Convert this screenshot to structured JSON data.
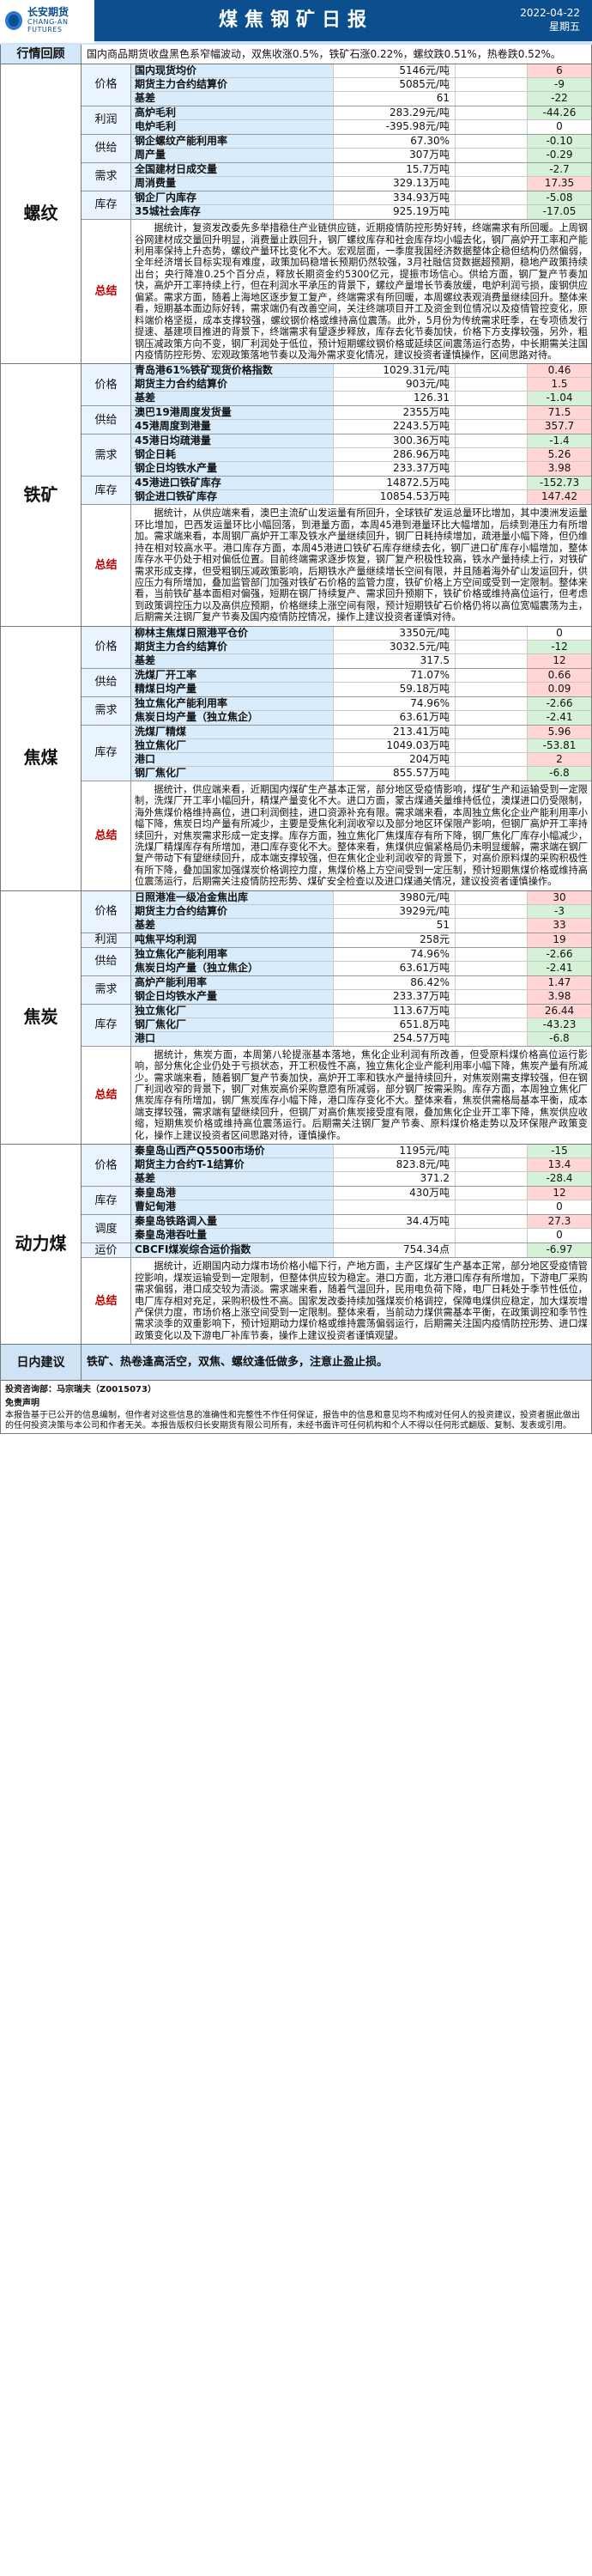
{
  "header": {
    "logo_cn": "长安期货",
    "logo_en": "CHANG-AN FUTURES",
    "title": "煤焦钢矿日报",
    "date": "2022-04-22",
    "weekday": "星期五"
  },
  "market": {
    "label": "行情回顾",
    "text": "国内商品期货收盘黑色系窄幅波动，双焦收涨0.5%，铁矿石涨0.22%，螺纹跌0.51%，热卷跌0.52%。"
  },
  "sections": [
    {
      "name": "螺纹",
      "groups": [
        {
          "label": "价格",
          "rows": [
            [
              "国内现货均价",
              "5146元/吨",
              "",
              "6"
            ],
            [
              "期货主力合约结算价",
              "5085元/吨",
              "",
              "-9"
            ],
            [
              "基差",
              "61",
              "",
              "-22"
            ]
          ]
        },
        {
          "label": "利润",
          "rows": [
            [
              "高炉毛利",
              "283.29元/吨",
              "",
              "-44.26"
            ],
            [
              "电炉毛利",
              "-395.98元/吨",
              "",
              "0"
            ]
          ]
        },
        {
          "label": "供给",
          "rows": [
            [
              "钢企螺纹产能利用率",
              "67.30%",
              "",
              "-0.10"
            ],
            [
              "周产量",
              "307万吨",
              "",
              "-0.29"
            ]
          ]
        },
        {
          "label": "需求",
          "rows": [
            [
              "全国建材日成交量",
              "15.7万吨",
              "",
              "-2.7"
            ],
            [
              "周消费量",
              "329.13万吨",
              "",
              "17.35"
            ]
          ]
        },
        {
          "label": "库存",
          "rows": [
            [
              "钢企厂内库存",
              "334.93万吨",
              "",
              "-5.08"
            ],
            [
              "35城社会库存",
              "925.19万吨",
              "",
              "-17.05"
            ]
          ]
        }
      ],
      "summary": "据统计，复资发改委先多举措稳住产业链供应链，近期疫情防控形势好转，终端需求有所回暖。上周钢谷网建材成交量回升明显，消费量止跌回升，钢厂螺纹库存和社会库存均小幅去化，钢厂高炉开工率和产能利用率保持上升态势，螺纹产量环比变化不大。宏观层面，一季度我国经济数据整体企稳但结构仍然偏弱，全年经济增长目标实现有难度，政策加码稳增长预期仍然较强，3月社融信贷数据超预期，稳地产政策持续出台；央行降准0.25个百分点，释放长期资金约5300亿元，提振市场信心。供给方面，钢厂复产节奏加快，高炉开工率持续上行，但在利润水平承压的背景下，螺纹产量增长节奏放缓，电炉利润亏损，废钢供应偏紧。需求方面，随着上海地区逐步复工复产，终端需求有所回暖，本周螺纹表观消费量继续回升。整体来看，短期基本面边际好转，需求端仍有改善空间，关注终端项目开工及资金到位情况以及疫情管控变化，原料端价格坚挺，成本支撑较强，螺纹钢价格或维持高位震荡。此外，5月份为传统需求旺季，在专项债发行提速、基建项目推进的背景下，终端需求有望逐步释放，库存去化节奏加快，价格下方支撑较强，另外，粗钢压减政策方向不变，钢厂利润处于低位，预计短期螺纹钢价格或延续区间震荡运行态势，中长期需关注国内疫情防控形势、宏观政策落地节奏以及海外需求变化情况，建议投资者谨慎操作，区间思路对待。"
    },
    {
      "name": "铁矿",
      "groups": [
        {
          "label": "价格",
          "rows": [
            [
              "青岛港61%铁矿现货价格指数",
              "1029.31元/吨",
              "",
              "0.46"
            ],
            [
              "期货主力合约结算价",
              "903元/吨",
              "",
              "1.5"
            ],
            [
              "基差",
              "126.31",
              "",
              "-1.04"
            ]
          ]
        },
        {
          "label": "供给",
          "rows": [
            [
              "澳巴19港周度发货量",
              "2355万吨",
              "",
              "71.5"
            ],
            [
              "45港周度到港量",
              "2243.5万吨",
              "",
              "357.7"
            ]
          ]
        },
        {
          "label": "需求",
          "rows": [
            [
              "45港日均疏港量",
              "300.36万吨",
              "",
              "-1.4"
            ],
            [
              "钢企日耗",
              "286.96万吨",
              "",
              "5.26"
            ],
            [
              "钢企日均铁水产量",
              "233.37万吨",
              "",
              "3.98"
            ]
          ]
        },
        {
          "label": "库存",
          "rows": [
            [
              "45港进口铁矿库存",
              "14872.5万吨",
              "",
              "-152.73"
            ],
            [
              "钢企进口铁矿库存",
              "10854.53万吨",
              "",
              "147.42"
            ]
          ]
        }
      ],
      "summary": "据统计，从供应端来看，澳巴主流矿山发运量有所回升，全球铁矿发运总量环比增加，其中澳洲发运量环比增加，巴西发运量环比小幅回落，到港量方面，本周45港到港量环比大幅增加，后续到港压力有所增加。需求端来看，本周钢厂高炉开工率及铁水产量继续回升，钢厂日耗持续增加，疏港量小幅下降，但仍维持在相对较高水平。港口库存方面，本周45港进口铁矿石库存继续去化，钢厂进口矿库存小幅增加，整体库存水平仍处于相对偏低位置。目前终端需求逐步恢复，钢厂复产积极性较高，铁水产量持续上行，对铁矿需求形成支撑，但受粗钢压减政策影响，后期铁水产量继续增长空间有限，并且随着海外矿山发运回升，供应压力有所增加，叠加监管部门加强对铁矿石价格的监管力度，铁矿价格上方空间或受到一定限制。整体来看，当前铁矿基本面相对偏强，短期在钢厂持续复产、需求回升预期下，铁矿价格或维持高位运行，但考虑到政策调控压力以及高供应预期，价格继续上涨空间有限，预计短期铁矿石价格仍将以高位宽幅震荡为主，后期需关注钢厂复产节奏及国内疫情防控情况，操作上建议投资者谨慎对待。"
    },
    {
      "name": "焦煤",
      "groups": [
        {
          "label": "价格",
          "rows": [
            [
              "柳林主焦煤日照港平仓价",
              "3350元/吨",
              "",
              "0"
            ],
            [
              "期货主力合约结算价",
              "3032.5元/吨",
              "",
              "-12"
            ],
            [
              "基差",
              "317.5",
              "",
              "12"
            ]
          ]
        },
        {
          "label": "供给",
          "rows": [
            [
              "洗煤厂开工率",
              "71.07%",
              "",
              "0.66"
            ],
            [
              "精煤日均产量",
              "59.18万吨",
              "",
              "0.09"
            ]
          ]
        },
        {
          "label": "需求",
          "rows": [
            [
              "独立焦化产能利用率",
              "74.96%",
              "",
              "-2.66"
            ],
            [
              "焦炭日均产量（独立焦企）",
              "63.61万吨",
              "",
              "-2.41"
            ]
          ]
        },
        {
          "label": "库存",
          "rows": [
            [
              "洗煤厂精煤",
              "213.41万吨",
              "",
              "5.96"
            ],
            [
              "独立焦化厂",
              "1049.03万吨",
              "",
              "-53.81"
            ],
            [
              "港口",
              "204万吨",
              "",
              "2"
            ],
            [
              "钢厂焦化厂",
              "855.57万吨",
              "",
              "-6.8"
            ]
          ]
        }
      ],
      "summary": "据统计，供应端来看，近期国内煤矿生产基本正常，部分地区受疫情影响，煤矿生产和运输受到一定限制，洗煤厂开工率小幅回升，精煤产量变化不大。进口方面，蒙古煤通关量维持低位，澳煤进口仍受限制，海外焦煤价格维持高位，进口利润倒挂，进口资源补充有限。需求端来看，本周独立焦化企业产能利用率小幅下降，焦炭日均产量有所减少，主要是受焦化利润收窄以及部分地区环保限产影响，但钢厂高炉开工率持续回升，对焦炭需求形成一定支撑。库存方面，独立焦化厂焦煤库存有所下降，钢厂焦化厂库存小幅减少，洗煤厂精煤库存有所增加，港口库存变化不大。整体来看，焦煤供应偏紧格局仍未明显缓解，需求端在钢厂复产带动下有望继续回升，成本端支撑较强，但在焦化企业利润收窄的背景下，对高价原料煤的采购积极性有所下降，叠加国家加强煤炭价格调控力度，焦煤价格上方空间受到一定压制，预计短期焦煤价格或维持高位震荡运行，后期需关注疫情防控形势、煤矿安全检查以及进口煤通关情况，建议投资者谨慎操作。"
    },
    {
      "name": "焦炭",
      "groups": [
        {
          "label": "价格",
          "rows": [
            [
              "日照港准一级冶金焦出库",
              "3980元/吨",
              "",
              "30"
            ],
            [
              "期货主力合约结算价",
              "3929元/吨",
              "",
              "-3"
            ],
            [
              "基差",
              "51",
              "",
              "33"
            ]
          ]
        },
        {
          "label": "利润",
          "rows": [
            [
              "吨焦平均利润",
              "258元",
              "",
              "19"
            ]
          ]
        },
        {
          "label": "供给",
          "rows": [
            [
              "独立焦化产能利用率",
              "74.96%",
              "",
              "-2.66"
            ],
            [
              "焦炭日均产量（独立焦企）",
              "63.61万吨",
              "",
              "-2.41"
            ]
          ]
        },
        {
          "label": "需求",
          "rows": [
            [
              "高炉产能利用率",
              "86.42%",
              "",
              "1.47"
            ],
            [
              "钢企日均铁水产量",
              "233.37万吨",
              "",
              "3.98"
            ]
          ]
        },
        {
          "label": "库存",
          "rows": [
            [
              "独立焦化厂",
              "113.67万吨",
              "",
              "26.44"
            ],
            [
              "钢厂焦化厂",
              "651.8万吨",
              "",
              "-43.23"
            ],
            [
              "港口",
              "254.57万吨",
              "",
              "-6.8"
            ]
          ]
        }
      ],
      "summary": "据统计，焦炭方面，本周第八轮提涨基本落地，焦化企业利润有所改善，但受原料煤价格高位运行影响，部分焦化企业仍处于亏损状态，开工积极性不高，独立焦化企业产能利用率小幅下降，焦炭产量有所减少。需求端来看，随着钢厂复产节奏加快，高炉开工率和铁水产量持续回升，对焦炭刚需支撑较强，但在钢厂利润收窄的背景下，钢厂对焦炭高价采购意愿有所减弱，部分钢厂按需采购。库存方面，本周独立焦化厂焦炭库存有所增加，钢厂焦炭库存小幅下降，港口库存变化不大。整体来看，焦炭供需格局基本平衡，成本端支撑较强，需求端有望继续回升，但钢厂对高价焦炭接受度有限，叠加焦化企业开工率下降，焦炭供应收缩，短期焦炭价格或维持高位震荡运行。后期需关注钢厂复产节奏、原料煤价格走势以及环保限产政策变化，操作上建议投资者区间思路对待，谨慎操作。"
    },
    {
      "name": "动力煤",
      "groups": [
        {
          "label": "价格",
          "rows": [
            [
              "秦皇岛山西产Q5500市场价",
              "1195元/吨",
              "",
              "-15"
            ],
            [
              "期货主力合约T-1结算价",
              "823.8元/吨",
              "",
              "13.4"
            ],
            [
              "基差",
              "371.2",
              "",
              "-28.4"
            ]
          ]
        },
        {
          "label": "库存",
          "rows": [
            [
              "秦皇岛港",
              "430万吨",
              "",
              "12"
            ],
            [
              "曹妃甸港",
              "",
              "",
              "0"
            ]
          ]
        },
        {
          "label": "调度",
          "rows": [
            [
              "秦皇岛铁路调入量",
              "34.4万吨",
              "",
              "27.3"
            ],
            [
              "秦皇岛港吞吐量",
              "",
              "",
              "0"
            ]
          ]
        },
        {
          "label": "运价",
          "rows": [
            [
              "CBCFI煤炭综合运价指数",
              "754.34点",
              "",
              "-6.97"
            ]
          ]
        }
      ],
      "summary": "据统计，近期国内动力煤市场价格小幅下行，产地方面，主产区煤矿生产基本正常，部分地区受疫情管控影响，煤炭运输受到一定限制，但整体供应较为稳定。港口方面，北方港口库存有所增加，下游电厂采购需求偏弱，港口成交较为清淡。需求端来看，随着气温回升，民用电负荷下降，电厂日耗处于季节性低位，电厂库存相对充足，采购积极性不高。国家发改委持续加强煤炭价格调控，保障电煤供应稳定，加大煤炭增产保供力度，市场价格上涨空间受到一定限制。整体来看，当前动力煤供需基本平衡，在政策调控和季节性需求淡季的双重影响下，预计短期动力煤价格或维持震荡偏弱运行，后期需关注国内疫情防控形势、进口煤政策变化以及下游电厂补库节奏，操作上建议投资者谨慎观望。"
    }
  ],
  "advice": {
    "label": "日内建议",
    "text": "铁矿、热卷逢高活空，双焦、螺纹逢低做多，注意止盈止损。"
  },
  "footer": {
    "author": "投资咨询部：马宗瑞夫（Z0015073）",
    "disclaimer_title": "免责声明",
    "disclaimer": "本报告基于已公开的信息编制，但作者对这些信息的准确性和完整性不作任何保证，报告中的信息和意见均不构成对任何人的投资建议，投资者据此做出的任何投资决策与本公司和作者无关。本报告版权归长安期货有限公司所有，未经书面许可任何机构和个人不得以任何形式翻版、复制、发表或引用。"
  }
}
